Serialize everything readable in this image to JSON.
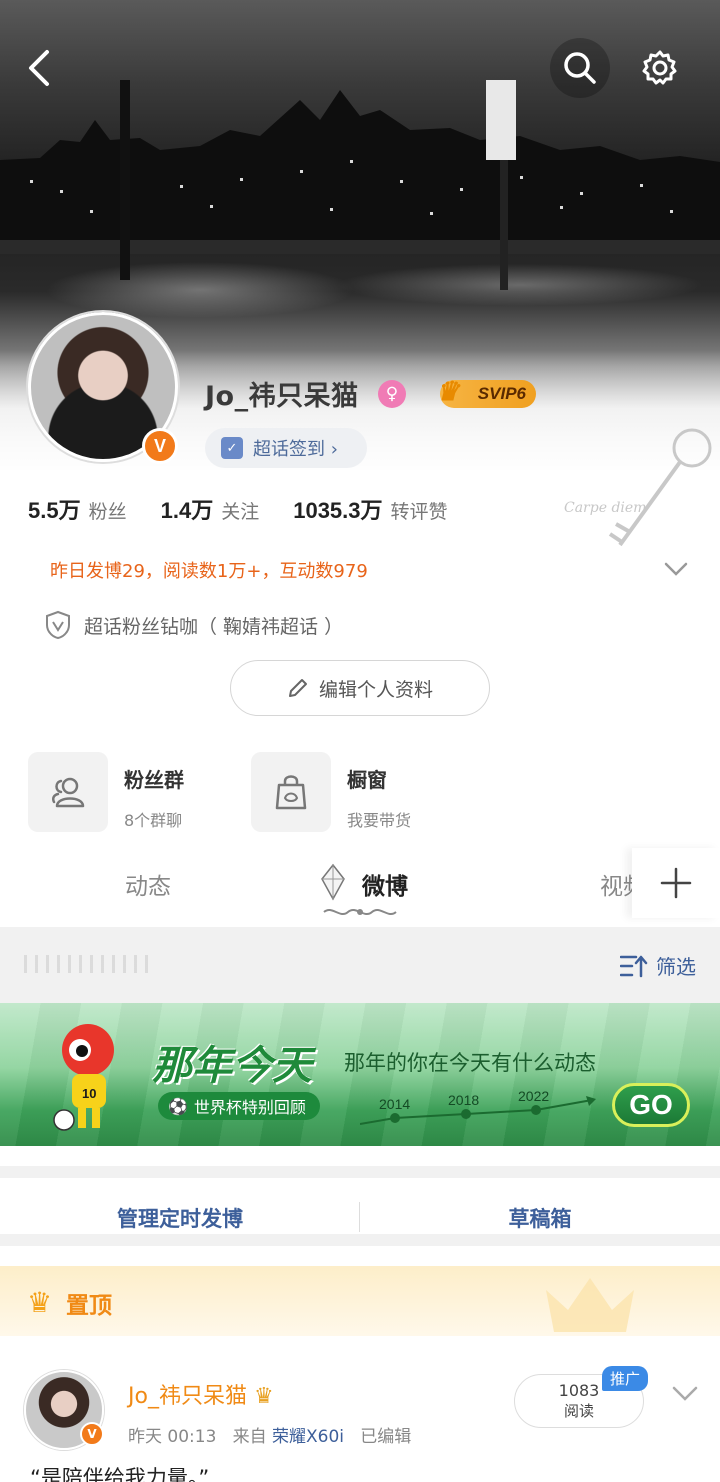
{
  "profile": {
    "username": "Jo_祎只呆猫",
    "gender_icon": "female-icon",
    "vip_badge": "SVIP6",
    "verified_mark": "V",
    "supertopic_button": "超话签到 ›",
    "stats": [
      {
        "value": "5.5万",
        "label": "粉丝"
      },
      {
        "value": "1.4万",
        "label": "关注"
      },
      {
        "value": "1035.3万",
        "label": "转评赞"
      }
    ],
    "summary": "昨日发博29，阅读数1万+，互动数979",
    "fan_badge": "超话粉丝钻咖（ 鞠婧祎超话 ）",
    "edit_button": "编辑个人资料"
  },
  "features": [
    {
      "title": "粉丝群",
      "subtitle": "8个群聊",
      "icon": "group-icon"
    },
    {
      "title": "橱窗",
      "subtitle": "我要带货",
      "icon": "shopping-bag-icon"
    }
  ],
  "tabs": [
    {
      "label": "动态"
    },
    {
      "label": "微博"
    },
    {
      "label": "视频"
    }
  ],
  "filter_label": "筛选",
  "banner": {
    "title": "那年今天",
    "subtitle": "那年的你在今天有什么动态",
    "tag": "世界杯特别回顾",
    "years": [
      "2014",
      "2018",
      "2022"
    ],
    "go": "GO",
    "mascot_number": "10"
  },
  "manage": {
    "scheduled": "管理定时发博",
    "drafts": "草稿箱"
  },
  "pinned": {
    "label": "置顶",
    "post": {
      "author": "Jo_祎只呆猫",
      "time": "昨天 00:13",
      "from_prefix": "来自",
      "device": "荣耀X60i",
      "edited": "已编辑",
      "reads": "1083",
      "reads_label": "阅读",
      "ad_tag": "推广",
      "text": "“是陪伴给我力量。”"
    }
  },
  "colors": {
    "accent_orange": "#f08a15",
    "link_blue": "#3d5f9a",
    "summary_orange": "#e8641a",
    "vip_gold": "#f0a020",
    "verified_orange": "#f27a1a"
  }
}
